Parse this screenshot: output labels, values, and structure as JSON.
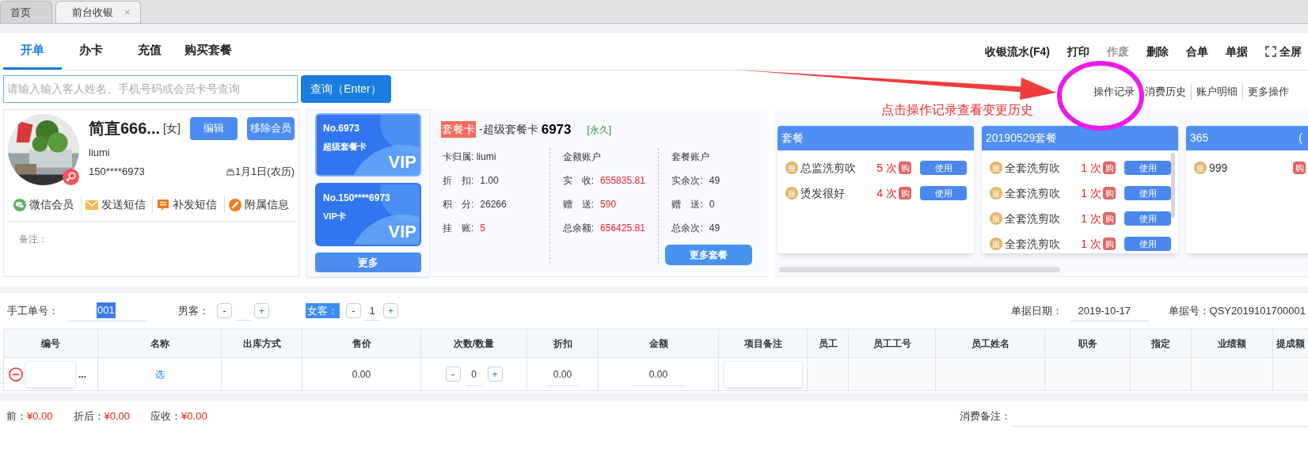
{
  "window_tabs": [
    {
      "label": "首页",
      "selected": false
    },
    {
      "label": "前台收银",
      "selected": true,
      "close": "×"
    }
  ],
  "nav_tabs": [
    {
      "label": "开单",
      "selected": true
    },
    {
      "label": "办卡",
      "selected": false
    },
    {
      "label": "充值",
      "selected": false
    },
    {
      "label": "购买套餐",
      "selected": false
    }
  ],
  "toolbar": [
    {
      "label": "收银流水(F4)",
      "disabled": false
    },
    {
      "label": "打印",
      "disabled": false
    },
    {
      "label": "作废",
      "disabled": true
    },
    {
      "label": "删除",
      "disabled": false
    },
    {
      "label": "合单",
      "disabled": false
    },
    {
      "label": "单据",
      "disabled": false
    },
    {
      "label": "全屏",
      "disabled": false,
      "kind": "fullscreen"
    }
  ],
  "search": {
    "placeholder": "请输入输入客人姓名、手机号码或会员卡号查询",
    "button": "查询（Enter）"
  },
  "links": [
    "操作记录",
    "消费历史",
    "账户明细",
    "更多操作"
  ],
  "annotation": {
    "text": "点击操作记录查看变更历史"
  },
  "member": {
    "name": "简直666...",
    "gender": "[女]",
    "edit": "编辑",
    "remove": "移除会员",
    "account": "liumi",
    "phone": "150****6973",
    "birthday": "1月1日(农历)",
    "actions": [
      {
        "kind": "wechat",
        "label": "微信会员"
      },
      {
        "kind": "mail",
        "label": "发送短信"
      },
      {
        "kind": "message",
        "label": "补发短信"
      },
      {
        "kind": "link",
        "label": "附属信息"
      }
    ],
    "remark_label": "备注："
  },
  "cards": [
    {
      "number": "No.6973",
      "name": "超级套餐卡",
      "badge": "VIP",
      "selected": true
    },
    {
      "number": "No.150****6973",
      "name": "VIP卡",
      "badge": "VIP",
      "selected": false
    }
  ],
  "more_cards": "更多",
  "card_info": {
    "type": "套餐卡",
    "title": "-超级套餐卡",
    "number": "6973",
    "validity": "[永久]",
    "columns": [
      {
        "heading": "卡归属: liumi",
        "rows": [
          {
            "label": "折　扣:",
            "value": "1.00",
            "emphasis": false
          },
          {
            "label": "积　分:",
            "value": "26266",
            "emphasis": false
          },
          {
            "label": "挂　账:",
            "value": "5",
            "emphasis": true
          }
        ]
      },
      {
        "heading": "金额账户",
        "rows": [
          {
            "label": "实　收:",
            "value": "655835.81",
            "emphasis": true
          },
          {
            "label": "赠　送:",
            "value": "590",
            "emphasis": true
          },
          {
            "label": "总余额:",
            "value": "656425.81",
            "emphasis": true
          }
        ]
      },
      {
        "heading": "套餐账户",
        "rows": [
          {
            "label": "实余次:",
            "value": "49",
            "emphasis": false
          },
          {
            "label": "赠　送:",
            "value": "0",
            "emphasis": false
          },
          {
            "label": "总余次:",
            "value": "49",
            "emphasis": false
          }
        ],
        "button": "更多套餐"
      }
    ]
  },
  "packages": [
    {
      "title": "套餐",
      "items": [
        {
          "badge": "服",
          "name": "总监洗剪吹",
          "count": "5 次",
          "buy": "购",
          "use": "使用"
        },
        {
          "badge": "服",
          "name": "烫发很好",
          "count": "4 次",
          "buy": "购",
          "use": "使用"
        }
      ]
    },
    {
      "title": "20190529套餐",
      "scrollable": true,
      "items": [
        {
          "badge": "服",
          "name": "全套洗剪吹",
          "count": "1 次",
          "buy": "购",
          "use": "使用"
        },
        {
          "badge": "服",
          "name": "全套洗剪吹",
          "count": "1 次",
          "buy": "购",
          "use": "使用"
        },
        {
          "badge": "服",
          "name": "全套洗剪吹",
          "count": "1 次",
          "buy": "购",
          "use": "使用"
        },
        {
          "badge": "服",
          "name": "全套洗剪吹",
          "count": "1 次",
          "buy": "购",
          "use": "使用"
        }
      ]
    },
    {
      "title": "365",
      "title_extra": "(",
      "items": [
        {
          "badge": "服",
          "name": "999",
          "buy": "购"
        }
      ]
    }
  ],
  "form": {
    "order_label": "手工单号：",
    "order_value": "001",
    "guests": [
      {
        "label": "男客：",
        "selected": false,
        "minus": "-",
        "plus": "+"
      },
      {
        "label": "女客：",
        "selected": true,
        "minus": "-",
        "value": "1",
        "plus": "+"
      }
    ],
    "date_label": "单据日期：",
    "date": "2019-10-17",
    "bill_label": "单据号：",
    "bill": "QSY2019101700001"
  },
  "table": {
    "columns": [
      "编号",
      "名称",
      "出库方式",
      "售价",
      "次数/数量",
      "折扣",
      "金额",
      "项目备注",
      "员工",
      "员工工号",
      "员工姓名",
      "职务",
      "指定",
      "业绩额",
      "提成额"
    ],
    "row": {
      "more": "...",
      "pick": "选",
      "price": "0.00",
      "minus": "-",
      "qty": "0",
      "plus": "+",
      "discount": "0.00",
      "amount": "0.00"
    }
  },
  "totals": [
    {
      "label": "前：",
      "value": "¥0.00"
    },
    {
      "label": "折后：",
      "value": "¥0.00"
    },
    {
      "label": "应收：",
      "value": "¥0.00"
    }
  ],
  "consume_remark": "消费备注："
}
